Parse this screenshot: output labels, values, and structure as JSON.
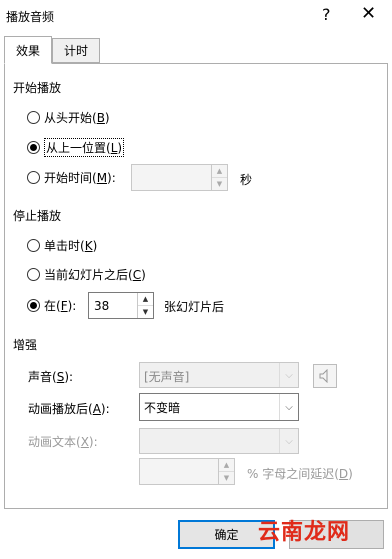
{
  "window": {
    "title": "播放音频",
    "help_glyph": "?",
    "close_glyph": "✕"
  },
  "tabs": [
    {
      "label": "效果",
      "active": true
    },
    {
      "label": "计时",
      "active": false
    }
  ],
  "start_group": {
    "title": "开始播放",
    "options": [
      {
        "label": "从头开始(",
        "key": "B",
        "suffix": ")",
        "checked": false
      },
      {
        "label": "从上一位置(",
        "key": "L",
        "suffix": ")",
        "checked": true
      },
      {
        "label": "开始时间(",
        "key": "M",
        "suffix": "):",
        "checked": false
      }
    ],
    "start_time_value": "",
    "seconds_label": "秒"
  },
  "stop_group": {
    "title": "停止播放",
    "options": [
      {
        "label": "单击时(",
        "key": "K",
        "suffix": ")",
        "checked": false
      },
      {
        "label": "当前幻灯片之后(",
        "key": "C",
        "suffix": ")",
        "checked": false
      },
      {
        "label": "在(",
        "key": "F",
        "suffix": "):",
        "checked": true
      }
    ],
    "after_slides_value": "38",
    "after_slides_label": "张幻灯片后"
  },
  "enhance_group": {
    "title": "增强",
    "sound_label_prefix": "声音(",
    "sound_key": "S",
    "sound_label_suffix": "):",
    "sound_value": "[无声音]",
    "after_anim_prefix": "动画播放后(",
    "after_anim_key": "A",
    "after_anim_suffix": "):",
    "after_anim_value": "不变暗",
    "anim_text_prefix": "动画文本(",
    "anim_text_key": "X",
    "anim_text_suffix": "):",
    "anim_text_value": "",
    "letter_delay_value": "",
    "letter_delay_prefix": "% 字母之间延迟(",
    "letter_delay_key": "D",
    "letter_delay_suffix": ")"
  },
  "buttons": {
    "ok": "确定",
    "cancel": ""
  },
  "watermark": {
    "text": "云南龙网",
    "color": "#e02b1a"
  },
  "icons": {
    "sound": "speaker-icon",
    "spin_up": "▲",
    "spin_down": "▼",
    "dropdown": "chevron-down-icon"
  }
}
